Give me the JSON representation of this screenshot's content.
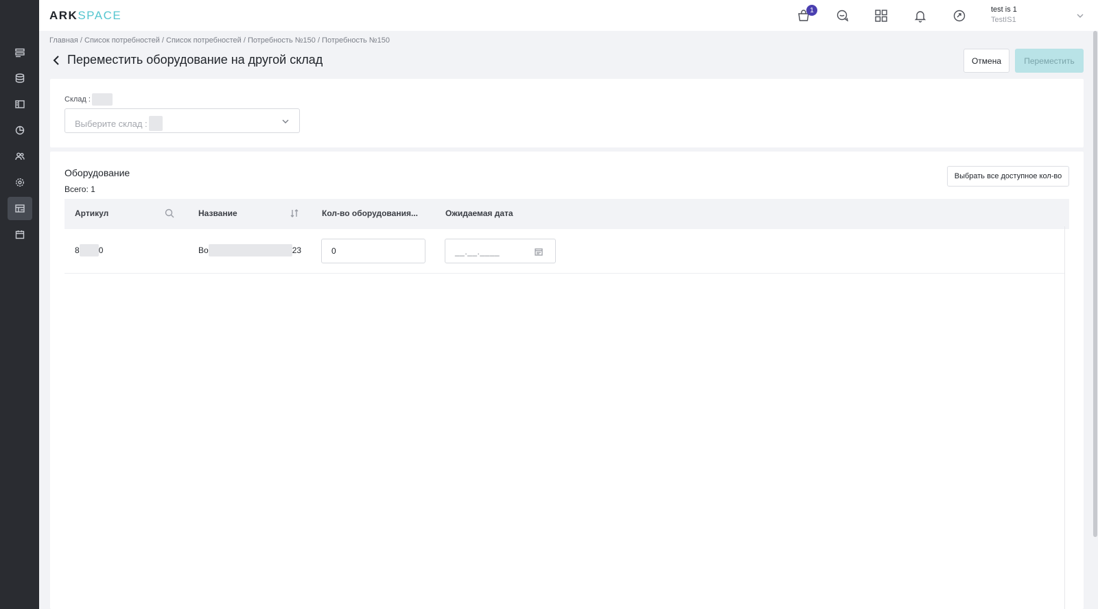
{
  "brand": {
    "logo_left": "ARK",
    "logo_right": "SPACE"
  },
  "header": {
    "cart_badge": "1",
    "icons": [
      "cart-icon",
      "chat-icon",
      "apps-grid-icon",
      "bell-icon",
      "sync-icon"
    ],
    "user_name": "test is 1",
    "user_sub": "TestIS1"
  },
  "breadcrumb": "Главная / Список потребностей / Список потребностей / Потребность №150 / Потребность №150",
  "page": {
    "title": "Переместить оборудование на другой склад",
    "cancel_label": "Отмена",
    "move_label": "Переместить"
  },
  "warehouse": {
    "label": "Склад :",
    "placeholder": "Выберите склад :"
  },
  "equipment": {
    "title": "Оборудование",
    "total": "Всего: 1",
    "select_all_label": "Выбрать все доступное кол-во",
    "columns": [
      "Артикул",
      "Название",
      "Кол-во оборудования...",
      "Ожидаемая дата"
    ],
    "rows": [
      {
        "article_start": "8",
        "article_end": "0",
        "name_start": "Bo",
        "name_end": "23",
        "qty": "0",
        "date_mask": "__.__.____"
      }
    ]
  },
  "colors": {
    "sidebar": "#2a2c31",
    "accent": "#55c6cf",
    "badge": "#4a3fb0",
    "move_button_disabled": "#b9e3e7"
  }
}
